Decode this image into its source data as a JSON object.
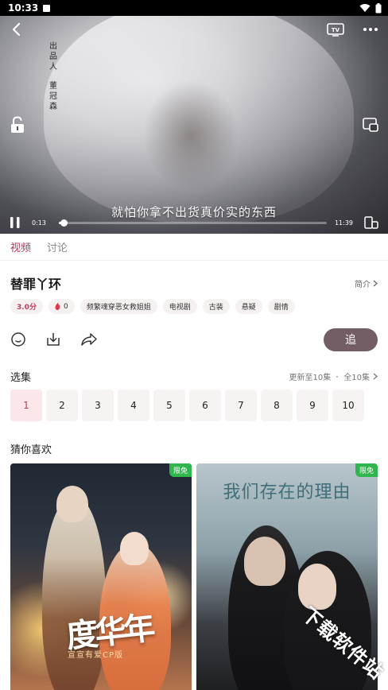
{
  "status_bar": {
    "time": "10:33"
  },
  "player": {
    "credit_lines": [
      "出品人",
      "董冠森"
    ],
    "subtitle": "就怕你拿不出货真价实的东西",
    "current_time": "0:13",
    "duration": "11:39",
    "progress_fraction": 0.019
  },
  "tabs": [
    {
      "label": "视频",
      "active": true
    },
    {
      "label": "讨论",
      "active": false
    }
  ],
  "show": {
    "title": "替罪丫环",
    "intro_label": "简介",
    "score": "3.0分",
    "heat": "0",
    "tags": [
      "频繁魂穿恶女救姐姐",
      "电视剧",
      "古装",
      "悬疑",
      "剧情"
    ]
  },
  "follow_label": "追",
  "episodes": {
    "title": "选集",
    "update_info": "更新至10集",
    "total_info": "全10集",
    "items": [
      "1",
      "2",
      "3",
      "4",
      "5",
      "6",
      "7",
      "8",
      "9",
      "10"
    ]
  },
  "recommend": {
    "title": "猜你喜欢",
    "cards": [
      {
        "badge": "限免",
        "poster_title": "度华年",
        "poster_subtitle": "宣宣有爱CP版"
      },
      {
        "badge": "限免",
        "poster_title": "我们存在的理由"
      }
    ]
  },
  "watermark": "下载软件站",
  "colors": {
    "accent": "#c23b5c",
    "follow_button": "#735e65",
    "badge": "#2fb64c"
  }
}
